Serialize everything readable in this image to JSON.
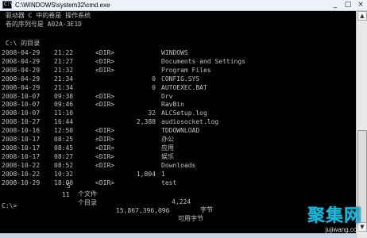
{
  "window": {
    "title": "C:\\WINDOWS\\system32\\cmd.exe",
    "icon_text": "C:\\",
    "buttons": [
      "_",
      "□",
      "×"
    ]
  },
  "console": {
    "header": [
      " 驱动器 C 中的卷是 操作系统",
      " 卷的序列号是 A02A-3E1D",
      " C:\\ 的目录"
    ],
    "entries": [
      {
        "date": "2008-04-29",
        "time": "21:22",
        "dir": "<DIR>",
        "size": "",
        "name": "WINDOWS"
      },
      {
        "date": "2008-04-29",
        "time": "21:27",
        "dir": "<DIR>",
        "size": "",
        "name": "Documents and Settings"
      },
      {
        "date": "2008-04-29",
        "time": "21:32",
        "dir": "<DIR>",
        "size": "",
        "name": "Program Files"
      },
      {
        "date": "2008-04-29",
        "time": "21:34",
        "dir": "",
        "size": "0",
        "name": "CONFIG.SYS"
      },
      {
        "date": "2008-04-29",
        "time": "21:34",
        "dir": "",
        "size": "0",
        "name": "AUTOEXEC.BAT"
      },
      {
        "date": "2008-10-07",
        "time": "09:38",
        "dir": "<DIR>",
        "size": "",
        "name": "Drv"
      },
      {
        "date": "2008-10-07",
        "time": "09:46",
        "dir": "<DIR>",
        "size": "",
        "name": "RavBin"
      },
      {
        "date": "2008-10-07",
        "time": "11:10",
        "dir": "",
        "size": "32",
        "name": "ALCSetup.log"
      },
      {
        "date": "2008-10-27",
        "time": "16:44",
        "dir": "",
        "size": "2,388",
        "name": "audiosocket.log"
      },
      {
        "date": "2008-10-16",
        "time": "12:50",
        "dir": "<DIR>",
        "size": "",
        "name": "TDDOWNLOAD"
      },
      {
        "date": "2008-10-17",
        "time": "08:25",
        "dir": "<DIR>",
        "size": "",
        "name": "办公"
      },
      {
        "date": "2008-10-17",
        "time": "08:45",
        "dir": "<DIR>",
        "size": "",
        "name": "应用"
      },
      {
        "date": "2008-10-17",
        "time": "08:27",
        "dir": "<DIR>",
        "size": "",
        "name": "娱乐"
      },
      {
        "date": "2008-10-22",
        "time": "08:52",
        "dir": "<DIR>",
        "size": "",
        "name": "Downloads"
      },
      {
        "date": "2008-10-22",
        "time": "10:32",
        "dir": "",
        "size": "1,804",
        "name": "1"
      },
      {
        "date": "2008-10-29",
        "time": "18:00",
        "dir": "<DIR>",
        "size": "",
        "name": "test"
      }
    ],
    "summary": [
      {
        "count": "5",
        "label": "个文件",
        "amount": "4,224",
        "unit": "字节"
      },
      {
        "count": "11",
        "label": "个目录",
        "amount": "15,867,396,096",
        "unit": "可用字节"
      }
    ],
    "prompt": "C:\\>"
  },
  "watermark": {
    "logo": "聚集网",
    "url": "jujiwang.com"
  }
}
